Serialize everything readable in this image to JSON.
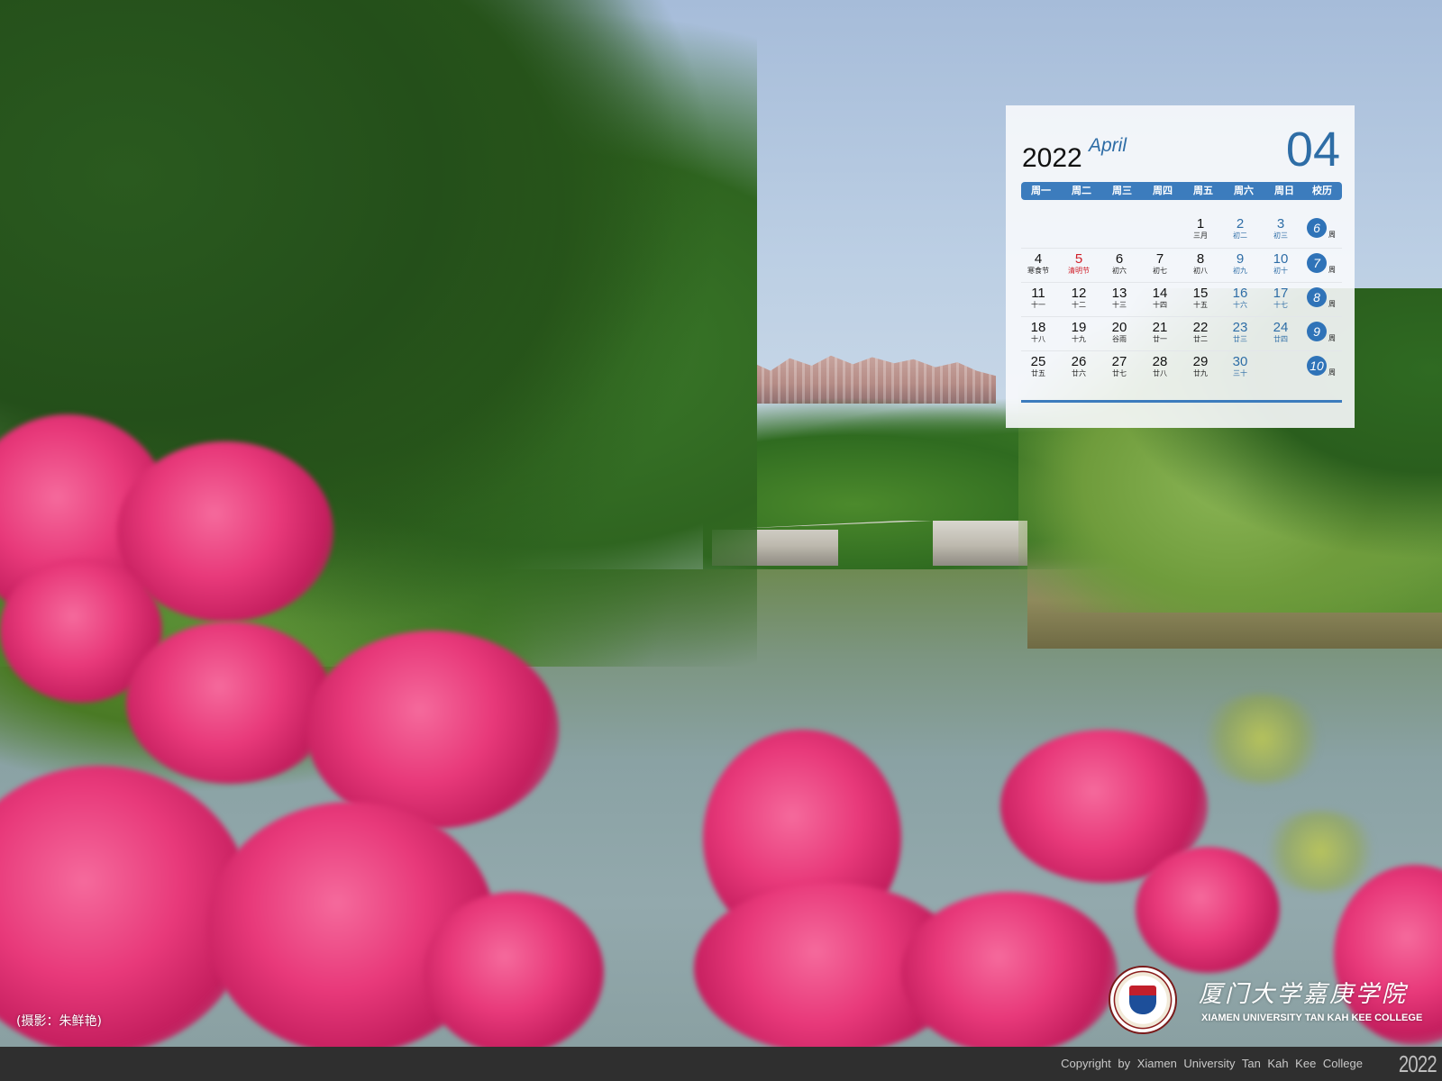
{
  "calendar": {
    "year": "2022",
    "month_en": "April",
    "month_num": "04",
    "weekdays": [
      "周一",
      "周二",
      "周三",
      "周四",
      "周五",
      "周六",
      "周日",
      "校历"
    ],
    "week_suffix": "周",
    "weeks": [
      {
        "week": "6",
        "days": [
          null,
          null,
          null,
          null,
          {
            "d": "1",
            "l": "三月"
          },
          {
            "d": "2",
            "l": "初二"
          },
          {
            "d": "3",
            "l": "初三"
          }
        ]
      },
      {
        "week": "7",
        "days": [
          {
            "d": "4",
            "l": "寒食节"
          },
          {
            "d": "5",
            "l": "清明节",
            "holiday": true
          },
          {
            "d": "6",
            "l": "初六"
          },
          {
            "d": "7",
            "l": "初七"
          },
          {
            "d": "8",
            "l": "初八"
          },
          {
            "d": "9",
            "l": "初九"
          },
          {
            "d": "10",
            "l": "初十"
          }
        ]
      },
      {
        "week": "8",
        "days": [
          {
            "d": "11",
            "l": "十一"
          },
          {
            "d": "12",
            "l": "十二"
          },
          {
            "d": "13",
            "l": "十三"
          },
          {
            "d": "14",
            "l": "十四"
          },
          {
            "d": "15",
            "l": "十五"
          },
          {
            "d": "16",
            "l": "十六"
          },
          {
            "d": "17",
            "l": "十七"
          }
        ]
      },
      {
        "week": "9",
        "days": [
          {
            "d": "18",
            "l": "十八"
          },
          {
            "d": "19",
            "l": "十九"
          },
          {
            "d": "20",
            "l": "谷雨"
          },
          {
            "d": "21",
            "l": "廿一"
          },
          {
            "d": "22",
            "l": "廿二"
          },
          {
            "d": "23",
            "l": "廿三"
          },
          {
            "d": "24",
            "l": "廿四"
          }
        ]
      },
      {
        "week": "10",
        "days": [
          {
            "d": "25",
            "l": "廿五"
          },
          {
            "d": "26",
            "l": "廿六"
          },
          {
            "d": "27",
            "l": "廿七"
          },
          {
            "d": "28",
            "l": "廿八"
          },
          {
            "d": "29",
            "l": "廿九"
          },
          {
            "d": "30",
            "l": "三十"
          },
          null
        ]
      }
    ]
  },
  "photo_credit": "(摄影：朱鲜艳)",
  "college": {
    "name_cn": "厦门大学嘉庚学院",
    "name_en": "XIAMEN UNIVERSITY TAN KAH KEE COLLEGE"
  },
  "footer": {
    "copyright": "Copyright by Xiamen University Tan Kah Kee College",
    "year": "2022"
  },
  "colors": {
    "accent_blue": "#2e6da6",
    "header_blue": "#3c7cbd",
    "holiday_red": "#d0202a",
    "footer_bg": "#2f2f2f"
  }
}
